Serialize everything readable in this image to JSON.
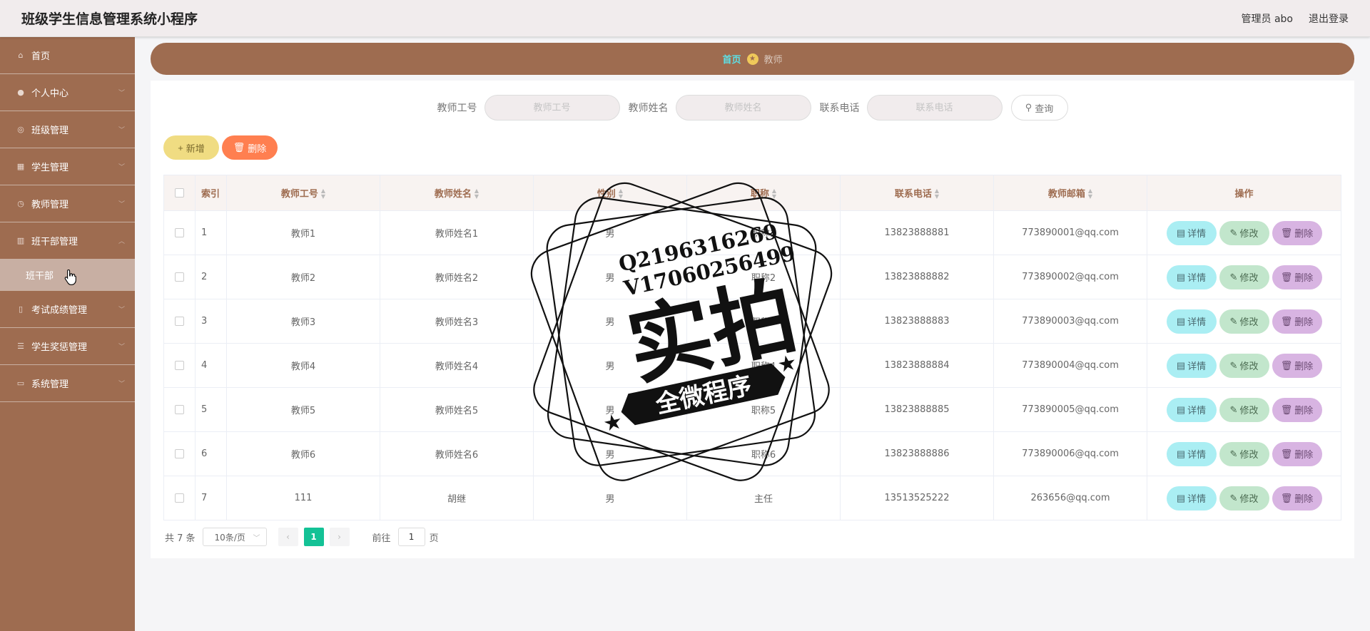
{
  "header": {
    "title": "班级学生信息管理系统小程序",
    "user": "管理员 abo",
    "logout": "退出登录"
  },
  "sidebar": {
    "items": [
      {
        "label": "首页",
        "icon": "home-icon"
      },
      {
        "label": "个人中心",
        "icon": "user-icon"
      },
      {
        "label": "班级管理",
        "icon": "globe-icon"
      },
      {
        "label": "学生管理",
        "icon": "grid-icon"
      },
      {
        "label": "教师管理",
        "icon": "clock-icon"
      },
      {
        "label": "班干部管理",
        "icon": "chart-icon"
      },
      {
        "label": "考试成绩管理",
        "icon": "mobile-icon"
      },
      {
        "label": "学生奖惩管理",
        "icon": "list-icon"
      },
      {
        "label": "系统管理",
        "icon": "monitor-icon"
      }
    ],
    "sub_item": "班干部"
  },
  "breadcrumb": {
    "home": "首页",
    "current": "教师"
  },
  "search": {
    "fields": [
      {
        "label": "教师工号",
        "placeholder": "教师工号"
      },
      {
        "label": "教师姓名",
        "placeholder": "教师姓名"
      },
      {
        "label": "联系电话",
        "placeholder": "联系电话"
      }
    ],
    "query_label": "查询"
  },
  "actions": {
    "add_label": "新增",
    "delete_label": "删除"
  },
  "table": {
    "columns": [
      "索引",
      "教师工号",
      "教师姓名",
      "性别",
      "职称",
      "联系电话",
      "教师邮箱",
      "操作"
    ],
    "rows": [
      {
        "index": "1",
        "id": "教师1",
        "name": "教师姓名1",
        "gender": "男",
        "title": "职称1",
        "phone": "13823888881",
        "email": "773890001@qq.com"
      },
      {
        "index": "2",
        "id": "教师2",
        "name": "教师姓名2",
        "gender": "男",
        "title": "职称2",
        "phone": "13823888882",
        "email": "773890002@qq.com"
      },
      {
        "index": "3",
        "id": "教师3",
        "name": "教师姓名3",
        "gender": "男",
        "title": "职称3",
        "phone": "13823888883",
        "email": "773890003@qq.com"
      },
      {
        "index": "4",
        "id": "教师4",
        "name": "教师姓名4",
        "gender": "男",
        "title": "职称4",
        "phone": "13823888884",
        "email": "773890004@qq.com"
      },
      {
        "index": "5",
        "id": "教师5",
        "name": "教师姓名5",
        "gender": "男",
        "title": "职称5",
        "phone": "13823888885",
        "email": "773890005@qq.com"
      },
      {
        "index": "6",
        "id": "教师6",
        "name": "教师姓名6",
        "gender": "男",
        "title": "职称6",
        "phone": "13823888886",
        "email": "773890006@qq.com"
      },
      {
        "index": "7",
        "id": "111",
        "name": "胡继",
        "gender": "男",
        "title": "主任",
        "phone": "13513525222",
        "email": "263656@qq.com"
      }
    ],
    "row_actions": {
      "detail": "详情",
      "edit": "修改",
      "delete": "删除"
    }
  },
  "pagination": {
    "total": "共 7 条",
    "page_size": "10条/页",
    "current_page": "1",
    "goto_prefix": "前往",
    "goto_value": "1",
    "goto_suffix": "页"
  },
  "watermark": {
    "line1": "Q2196316269",
    "line2": "V17060256499",
    "main": "实拍",
    "banner": "全微程序"
  },
  "colors": {
    "sidebar": "#9e6c50",
    "accent_page": "#14c296",
    "delete": "#ff7f50",
    "add": "#f0dc82"
  }
}
